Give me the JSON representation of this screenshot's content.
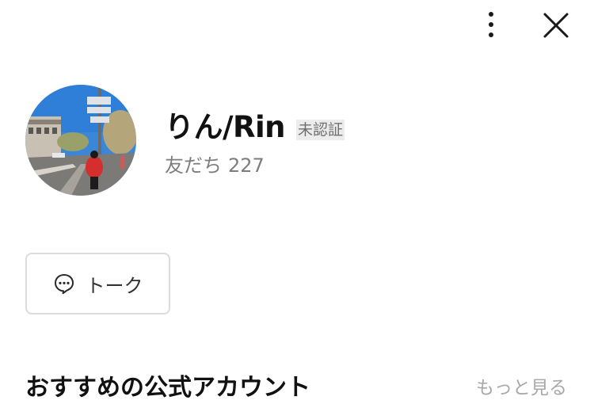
{
  "header": {
    "more_icon": "more-vertical-icon",
    "close_icon": "close-icon"
  },
  "profile": {
    "name": "りん/Rin",
    "verification_badge": "未認証",
    "friends_label": "友だち",
    "friends_count": "227"
  },
  "actions": {
    "talk_label": "トーク",
    "talk_icon": "chat-bubble-icon"
  },
  "recommended": {
    "title": "おすすめの公式アカウント",
    "see_more_label": "もっと見る"
  },
  "colors": {
    "background": "#ffffff",
    "text_primary": "#111111",
    "text_secondary": "#7d7d7d",
    "badge_bg": "#ececec",
    "border": "#dcdcdc",
    "link_gray": "#a9a9a9"
  }
}
